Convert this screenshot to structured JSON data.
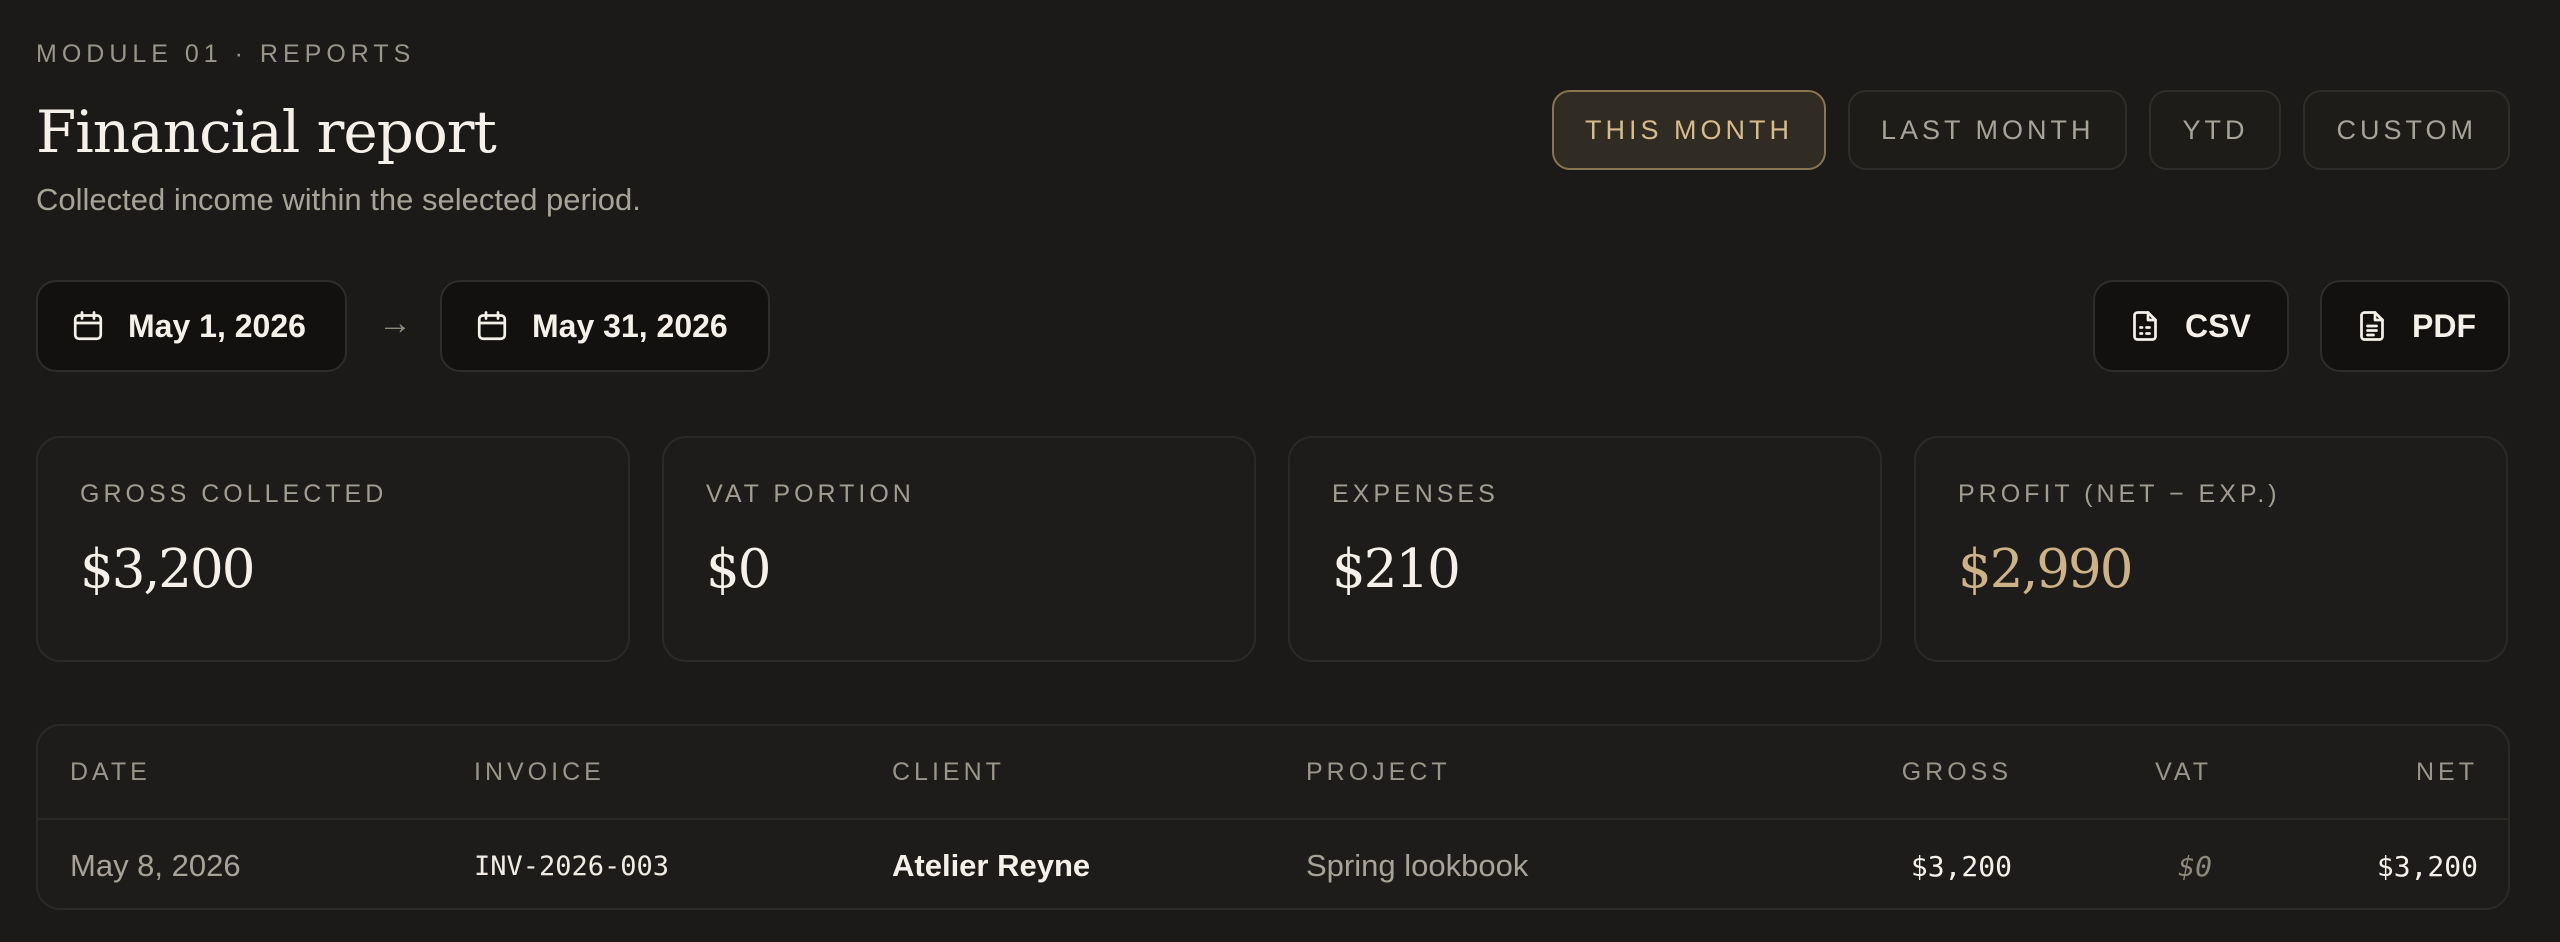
{
  "header": {
    "eyebrow": "MODULE 01 · REPORTS",
    "title": "Financial report",
    "subtitle": "Collected income within the selected period."
  },
  "periods": [
    {
      "label": "THIS MONTH",
      "active": true
    },
    {
      "label": "LAST MONTH",
      "active": false
    },
    {
      "label": "YTD",
      "active": false
    },
    {
      "label": "CUSTOM",
      "active": false
    }
  ],
  "date_range": {
    "from": "May 1, 2026",
    "arrow": "→",
    "to": "May 31, 2026"
  },
  "export": {
    "csv_label": "CSV",
    "pdf_label": "PDF"
  },
  "cards": [
    {
      "label": "GROSS COLLECTED",
      "value": "$3,200"
    },
    {
      "label": "VAT PORTION",
      "value": "$0"
    },
    {
      "label": "EXPENSES",
      "value": "$210"
    },
    {
      "label": "PROFIT (NET − EXP.)",
      "value": "$2,990"
    }
  ],
  "table": {
    "columns": [
      "DATE",
      "INVOICE",
      "CLIENT",
      "PROJECT",
      "GROSS",
      "VAT",
      "NET"
    ],
    "rows": [
      {
        "date": "May 8, 2026",
        "invoice": "INV-2026-003",
        "client": "Atelier Reyne",
        "project": "Spring lookbook",
        "gross": "$3,200",
        "vat": "$0",
        "net": "$3,200"
      }
    ]
  },
  "colors": {
    "background": "#1b1a18",
    "accent": "#d8bb8a",
    "profit": "#cdb187"
  },
  "icons": {
    "date": "calendar-icon",
    "csv": "csv-file-icon",
    "pdf": "pdf-file-icon"
  }
}
